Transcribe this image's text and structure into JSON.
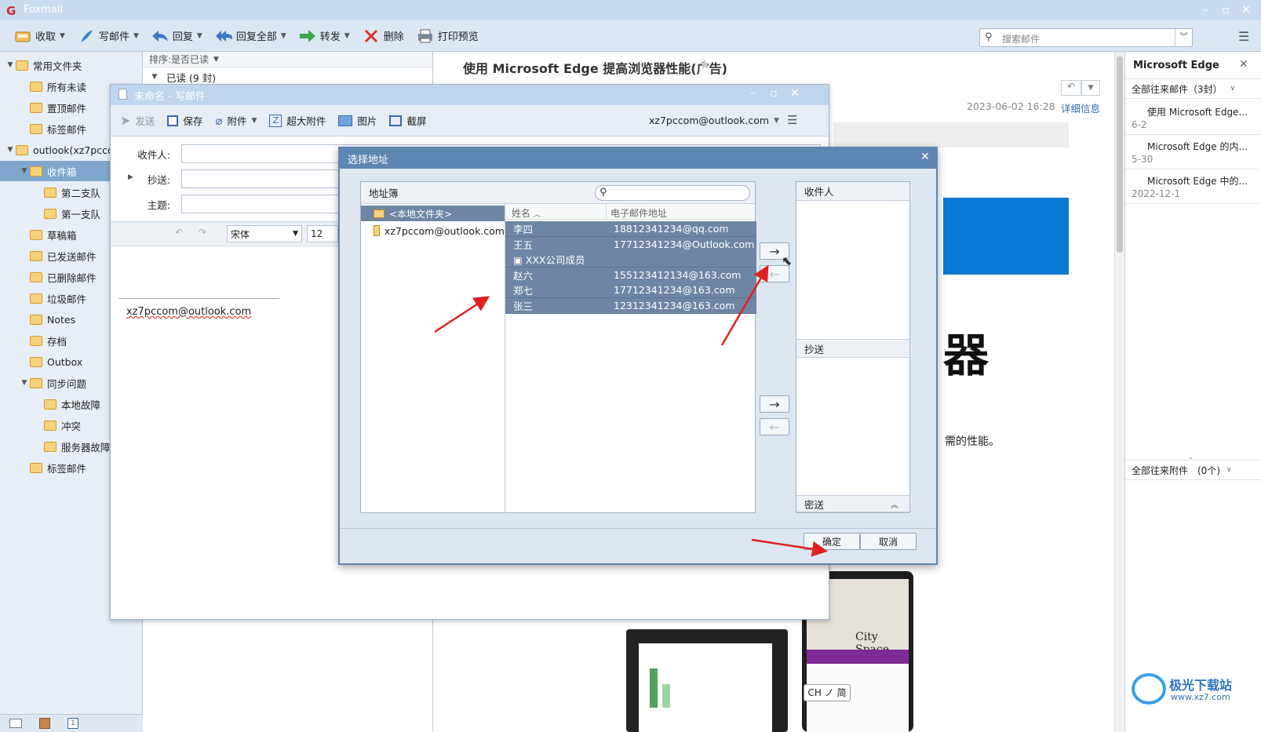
{
  "app": {
    "title": "Foxmail"
  },
  "toolbar": {
    "receive": "收取",
    "write": "写邮件",
    "reply": "回复",
    "reply_all": "回复全部",
    "forward": "转发",
    "delete": "删除",
    "print_preview": "打印预览",
    "search_placeholder": "搜索邮件"
  },
  "folders": [
    {
      "label": "常用文件夹",
      "indent": 0,
      "expand": true
    },
    {
      "label": "所有未读",
      "indent": 1
    },
    {
      "label": "置顶邮件",
      "indent": 1
    },
    {
      "label": "标签邮件",
      "indent": 1
    },
    {
      "label": "outlook(xz7pccom",
      "indent": 0,
      "expand": true
    },
    {
      "label": "收件箱",
      "indent": 1,
      "expand": true,
      "selected": true
    },
    {
      "label": "第二支队",
      "indent": 2
    },
    {
      "label": "第一支队",
      "indent": 2
    },
    {
      "label": "草稿箱",
      "indent": 1
    },
    {
      "label": "已发送邮件",
      "indent": 1
    },
    {
      "label": "已删除邮件",
      "indent": 1
    },
    {
      "label": "垃圾邮件",
      "indent": 1
    },
    {
      "label": "Notes",
      "indent": 1
    },
    {
      "label": "存档",
      "indent": 1
    },
    {
      "label": "Outbox",
      "indent": 1
    },
    {
      "label": "同步问题",
      "indent": 1,
      "expand": true
    },
    {
      "label": "本地故障",
      "indent": 2
    },
    {
      "label": "冲突",
      "indent": 2
    },
    {
      "label": "服务器故障",
      "indent": 2
    },
    {
      "label": "标签邮件",
      "indent": 1
    }
  ],
  "maillist": {
    "sort": "排序:是否已读",
    "group": "已读 (9 封)"
  },
  "reading": {
    "subject": "使用 Microsoft Edge 提高浏览器性能(广告)",
    "date": "2023-06-02 16:28",
    "details": "详细信息",
    "big_text": "器",
    "body_text": "需的性能。",
    "city_text": "City Space",
    "ime": "CH ノ 简"
  },
  "right": {
    "title": "Microsoft Edge",
    "all_mail": "全部往来邮件（3封）",
    "all_attach": "全部往来附件　(0个)",
    "items": [
      {
        "title": "使用 Microsoft Edge...",
        "date": "6-2"
      },
      {
        "title": "Microsoft Edge 的内...",
        "date": "5-30"
      },
      {
        "title": "Microsoft Edge 中的...",
        "date": "2022-12-1"
      }
    ]
  },
  "compose": {
    "title": "未命名 - 写邮件",
    "send": "发送",
    "save": "保存",
    "attach": "附件",
    "big_attach": "超大附件",
    "image": "图片",
    "screenshot": "截屏",
    "account": "xz7pccom@outlook.com",
    "to_label": "收件人:",
    "cc_label": "抄送:",
    "subject_label": "主题:",
    "font": "宋体",
    "size": "12",
    "signature": "xz7pccom@outlook.com"
  },
  "dialog": {
    "title": "选择地址",
    "address_book": "地址簿",
    "local_folder": "<本地文件夹>",
    "account": "xz7pccom@outlook.com",
    "col_name": "姓名",
    "col_email": "电子邮件地址",
    "contacts": [
      {
        "name": "李四",
        "email": "18812341234@qq.com"
      },
      {
        "name": "王五",
        "email": "17712341234@Outlook.com"
      },
      {
        "name": "XXX公司成员",
        "email": "",
        "group": true
      },
      {
        "name": "赵六",
        "email": "155123412134@163.com"
      },
      {
        "name": "郑七",
        "email": "17712341234@163.com"
      },
      {
        "name": "张三",
        "email": "12312341234@163.com"
      }
    ],
    "to": "收件人",
    "cc": "抄送",
    "bcc": "密送",
    "ok": "确定",
    "cancel": "取消"
  },
  "watermark": {
    "text": "极光下载站",
    "url": "www.xz7.com"
  }
}
